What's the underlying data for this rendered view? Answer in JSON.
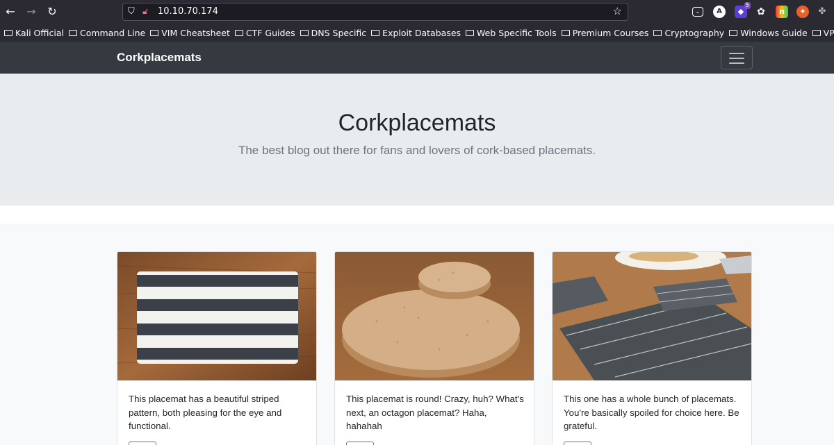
{
  "browser": {
    "url": "10.10.70.174",
    "extensions_badge": "5",
    "bookmarks": [
      "Kali Official",
      "Command Line",
      "VIM Cheatsheet",
      "CTF Guides",
      "DNS Specific",
      "Exploit Databases",
      "Web Specific Tools",
      "Premium Courses",
      "Cryptography",
      "Windows Guide",
      "VPN"
    ]
  },
  "navbar": {
    "brand": "Corkplacemats"
  },
  "hero": {
    "title": "Corkplacemats",
    "subtitle": "The best blog out there for fans and lovers of cork-based placemats."
  },
  "cards": [
    {
      "text": "This placemat has a beautiful striped pattern, both pleasing for the eye and functional.",
      "image": "striped-placemat-image"
    },
    {
      "text": "This placemat is round! Crazy, huh? What's next, an octagon placemat? Haha, hahahah",
      "image": "round-cork-placemat-image"
    },
    {
      "text": "This one has a whole bunch of placemats. You're basically spoiled for choice here. Be grateful.",
      "image": "patterned-placemats-image"
    }
  ]
}
